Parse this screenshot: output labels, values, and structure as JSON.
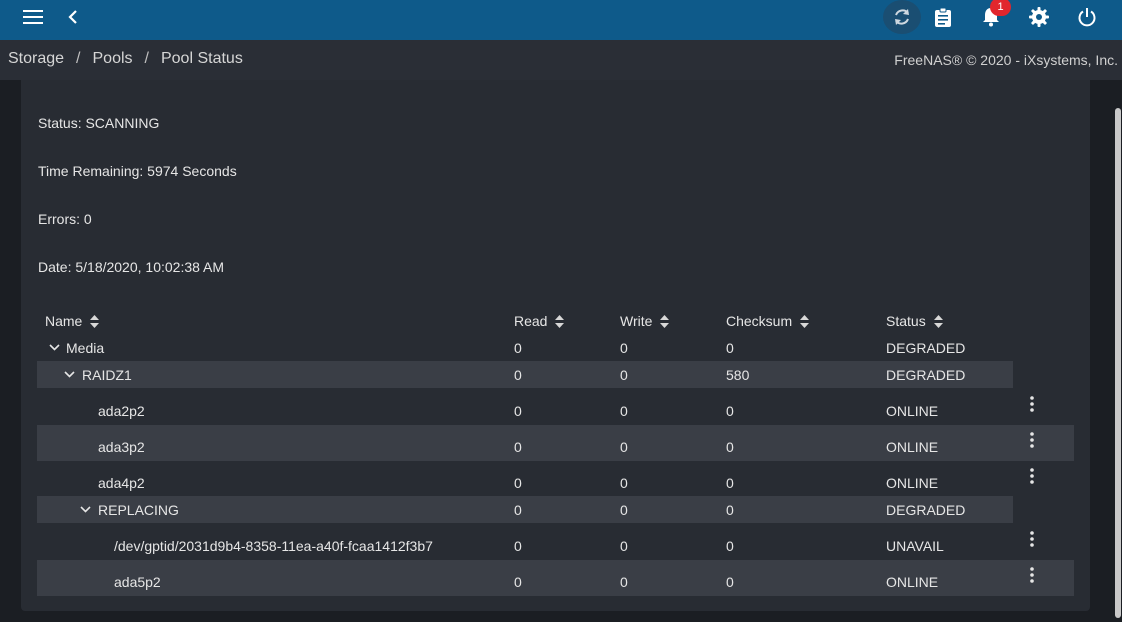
{
  "toolbar": {
    "menu_icon": "menu-icon",
    "back_icon": "chevron-left-icon",
    "refresh_icon": "refresh-icon",
    "tasks_icon": "clipboard-icon",
    "alerts_icon": "bell-icon",
    "alerts_count": "1",
    "settings_icon": "gear-icon",
    "power_icon": "power-icon"
  },
  "breadcrumb": {
    "items": [
      "Storage",
      "Pools",
      "Pool Status"
    ],
    "separator": "/"
  },
  "copyright": "FreeNAS® © 2020 - iXsystems, Inc.",
  "scan": {
    "status": "Status: SCANNING",
    "time_remaining": "Time Remaining: 5974 Seconds",
    "errors": "Errors: 0",
    "date": "Date: 5/18/2020, 10:02:38 AM"
  },
  "table": {
    "columns": [
      "Name",
      "Read",
      "Write",
      "Checksum",
      "Status"
    ],
    "rows": [
      {
        "name": "Media",
        "read": "0",
        "write": "0",
        "checksum": "0",
        "status": "DEGRADED"
      },
      {
        "name": "RAIDZ1",
        "read": "0",
        "write": "0",
        "checksum": "580",
        "status": "DEGRADED"
      },
      {
        "name": "ada2p2",
        "read": "0",
        "write": "0",
        "checksum": "0",
        "status": "ONLINE"
      },
      {
        "name": "ada3p2",
        "read": "0",
        "write": "0",
        "checksum": "0",
        "status": "ONLINE"
      },
      {
        "name": "ada4p2",
        "read": "0",
        "write": "0",
        "checksum": "0",
        "status": "ONLINE"
      },
      {
        "name": "REPLACING",
        "read": "0",
        "write": "0",
        "checksum": "0",
        "status": "DEGRADED"
      },
      {
        "name": "/dev/gptid/2031d9b4-8358-11ea-a40f-fcaa1412f3b7",
        "read": "0",
        "write": "0",
        "checksum": "0",
        "status": "UNAVAIL"
      },
      {
        "name": "ada5p2",
        "read": "0",
        "write": "0",
        "checksum": "0",
        "status": "ONLINE"
      }
    ]
  },
  "colors": {
    "topbar": "#0e5a8a",
    "card": "#282c33",
    "row_alt": "#3a3e46",
    "badge": "#e1262d"
  }
}
